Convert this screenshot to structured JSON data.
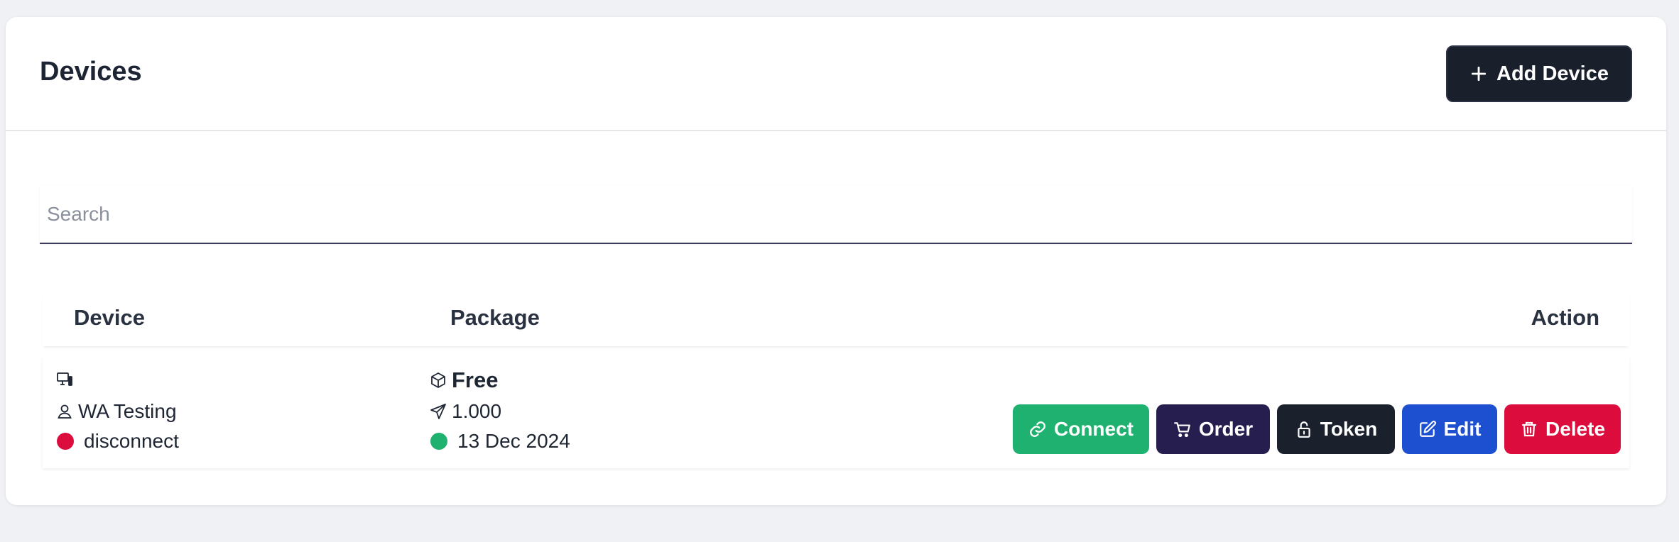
{
  "header": {
    "title": "Devices",
    "add_button_label": "Add Device"
  },
  "search": {
    "placeholder": "Search",
    "value": ""
  },
  "table": {
    "columns": [
      "Device",
      "Package",
      "Action"
    ],
    "rows": [
      {
        "device_name": "",
        "owner": "WA Testing",
        "status": "disconnect",
        "status_color": "#dc0c3d",
        "package": "Free",
        "quota": "1.000",
        "expiry": "13 Dec 2024",
        "expiry_color": "#1fb16f",
        "actions": {
          "connect": "Connect",
          "order": "Order",
          "token": "Token",
          "edit": "Edit",
          "delete": "Delete"
        }
      }
    ]
  },
  "colors": {
    "connect": "#1fb16f",
    "order": "#251e4e",
    "token": "#1b202d",
    "edit": "#1d4fd1",
    "delete": "#dc0c3d",
    "primary_dark": "#1a1f2c"
  },
  "icons": {
    "add": "plus-icon",
    "device": "monitor-icon",
    "owner": "user-icon",
    "package": "box-icon",
    "quota": "send-icon",
    "connect": "link-icon",
    "order": "cart-icon",
    "token": "lock-icon",
    "edit": "edit-icon",
    "delete": "trash-icon"
  }
}
